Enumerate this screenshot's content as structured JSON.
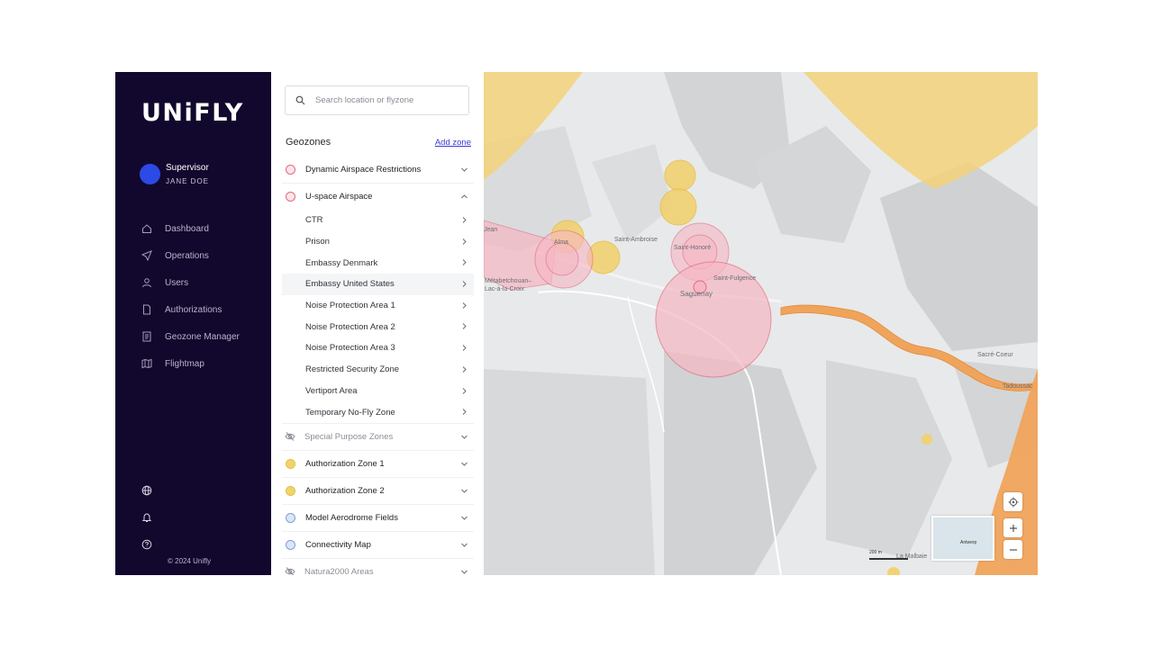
{
  "app": {
    "logo": "UNiFLY",
    "copyright": "© 2024 Unifly"
  },
  "user": {
    "role": "Supervisor",
    "name": "JANE DOE"
  },
  "nav": [
    {
      "label": "Dashboard",
      "icon": "home-icon"
    },
    {
      "label": "Operations",
      "icon": "send-icon"
    },
    {
      "label": "Users",
      "icon": "user-icon"
    },
    {
      "label": "Authorizations",
      "icon": "document-icon"
    },
    {
      "label": "Geozone Manager",
      "icon": "ledger-icon"
    },
    {
      "label": "Flightmap",
      "icon": "map-icon"
    }
  ],
  "bottom_icons": [
    "globe-icon",
    "bell-icon",
    "help-icon"
  ],
  "search": {
    "placeholder": "Search location or flyzone"
  },
  "geozones": {
    "title": "Geozones",
    "add_label": "Add zone",
    "groups": [
      {
        "label": "Dynamic Airspace Restrictions",
        "color": "#f4a5b3",
        "state": "collapsed"
      },
      {
        "label": "U-space Airspace",
        "color": "#f4a5b3",
        "state": "expanded",
        "items": [
          "CTR",
          "Prison",
          "Embassy Denmark",
          "Embassy United States",
          "Noise Protection Area 1",
          "Noise Protection Area 2",
          "Noise Protection Area 3",
          "Restricted Security Zone",
          "Vertiport Area",
          "Temporary No-Fly Zone"
        ]
      },
      {
        "label": "Special Purpose Zones",
        "icon": "eye-off-icon",
        "state": "hidden"
      },
      {
        "label": "Authorization Zone 1",
        "color": "#f2d36b",
        "state": "collapsed"
      },
      {
        "label": "Authorization Zone 2",
        "color": "#f2d36b",
        "state": "collapsed"
      },
      {
        "label": "Model Aerodrome Fields",
        "color": "#b9cdee",
        "state": "collapsed"
      },
      {
        "label": "Connectivity Map",
        "color": "#b9cdee",
        "state": "collapsed"
      },
      {
        "label": "Natura2000 Areas",
        "icon": "eye-off-icon",
        "state": "hidden"
      }
    ]
  },
  "map": {
    "labels": [
      "Saint-Ambroise",
      "Saint-Honoré",
      "Saint-Fulgence",
      "Saguenay",
      "Métabetchouan–Lac-à-la-Croix",
      "Sacré-Coeur",
      "Tadoussac",
      "La Malbaie",
      "Alma",
      "Jean"
    ],
    "minimap_label": "Antwerp",
    "scale_label": "200 m"
  }
}
